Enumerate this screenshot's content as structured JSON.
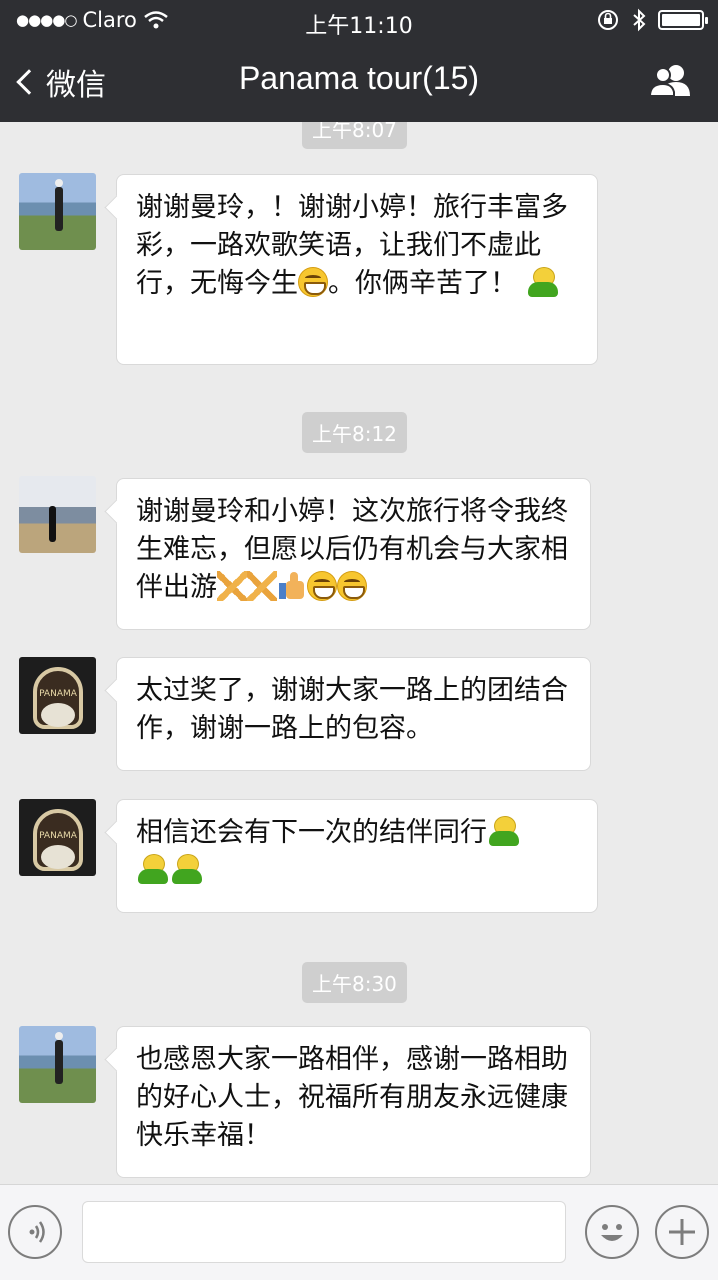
{
  "status_bar": {
    "signal_dots": "●●●●○",
    "carrier": "Claro",
    "time": "上午11:10"
  },
  "nav": {
    "back_label": "微信",
    "title": "Panama tour(15)"
  },
  "chat": {
    "timestamps": [
      "上午8:07",
      "上午8:12",
      "上午8:30"
    ],
    "messages": [
      {
        "text": "谢谢曼玲，！谢谢小婷！旅行丰富多彩，一路欢歌笑语，让我们不虚此行，无悔今生",
        "tail": "。你俩辛苦了！"
      },
      {
        "text": "谢谢曼玲和小婷！这次旅行将令我终生难忘，但愿以后仍有机会与大家相伴出游"
      },
      {
        "text": "太过奖了，谢谢大家一路上的团结合作，谢谢一路上的包容。"
      },
      {
        "text": "相信还会有下一次的结伴同行"
      },
      {
        "text": "也感恩大家一路相伴，感谢一路相助的好心人士，祝福所有朋友永远健康快乐幸福！"
      }
    ]
  },
  "icons": [
    "back-chevron-icon",
    "group-members-icon",
    "wifi-icon",
    "lock-rotation-icon",
    "bluetooth-icon",
    "battery-icon",
    "voice-icon",
    "emoji-icon",
    "plus-icon",
    "grin-emoji",
    "frog-emoji",
    "pray-emoji",
    "thumbs-up-emoji"
  ]
}
